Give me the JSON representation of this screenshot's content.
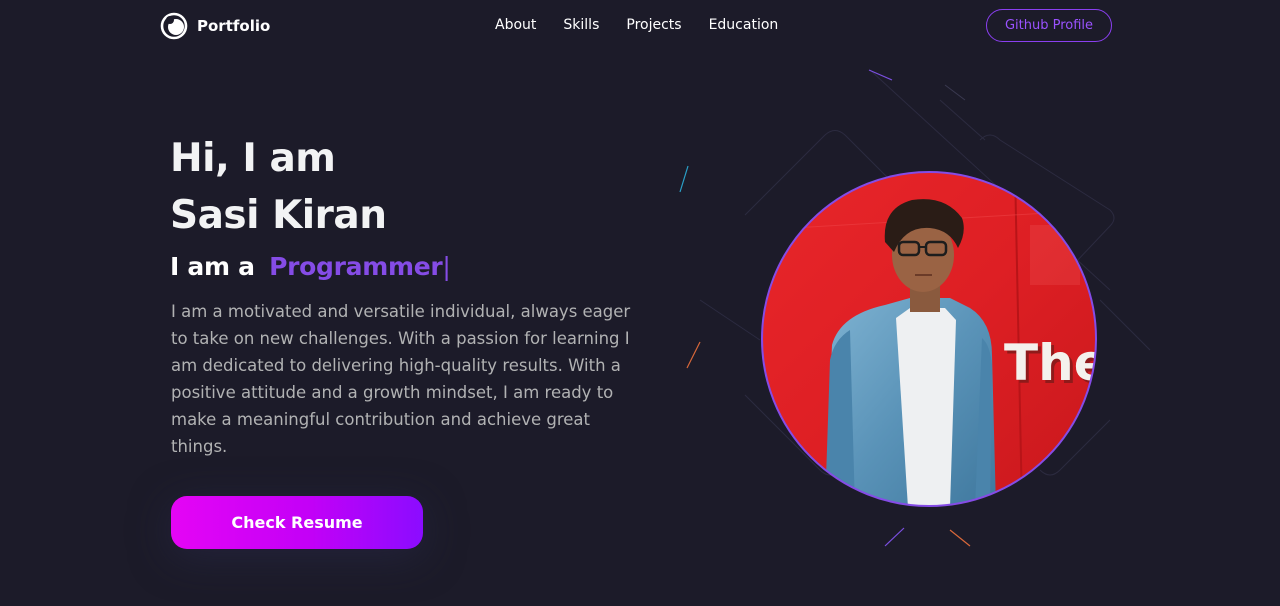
{
  "nav": {
    "logo_text": "Portfolio",
    "links": [
      "About",
      "Skills",
      "Projects",
      "Education"
    ],
    "github_label": "Github Profile"
  },
  "hero": {
    "greeting_line1": "Hi, I am",
    "greeting_line2": "Sasi Kiran",
    "role_prefix": "I am a",
    "role_word": "Programmer",
    "cursor": "|",
    "description": "I am a motivated and versatile individual, always eager to take on new challenges. With a passion for learning I am dedicated to delivering high-quality results. With a positive attitude and a growth mindset, I am ready to make a meaningful contribution and achieve great things.",
    "resume_label": "Check Resume"
  },
  "colors": {
    "background": "#1c1b29",
    "accent": "#854ce6",
    "button_gradient_start": "#e505f5",
    "button_gradient_end": "#8b0cff"
  }
}
